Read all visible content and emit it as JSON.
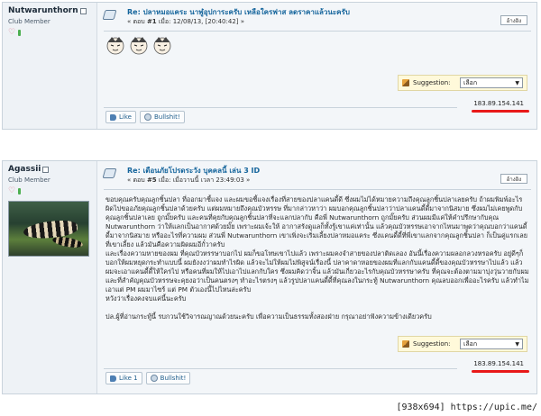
{
  "posts": [
    {
      "username": "Nutwarunthorn",
      "user_title": "Club Member",
      "title": "Re: ปลาหมอแคระ นาฬูอุปการะครับ เหลือใครฟาส ลดราคาแล้วนะครับ",
      "meta_prefix": "« ตอบ ",
      "post_no": "#1",
      "meta_mid": " เมื่อ: ",
      "date": "12/08/13, [20:40:42]",
      "meta_suffix": " »",
      "quote_label": "อ้างอิง",
      "suggestion_label": "Suggestion:",
      "suggestion_value": "เลือก",
      "ip": "183.89.154.141",
      "like_label": "Like",
      "bullshit_label": "Bullshit!"
    },
    {
      "username": "Agassii",
      "user_title": "Club Member",
      "title": "Re: เตือนภัยโปรดระวัง บุคคลนี้ เล่น 3 ID",
      "meta_prefix": "« ตอบ ",
      "post_no": "#5",
      "meta_mid": " เมื่อ: ",
      "date": "เมื่อวานนี้ เวลา 23:49:03",
      "meta_suffix": " »",
      "quote_label": "อ้างอิง",
      "body": "ขอบคุณครับคุณลูกชิ้นปลา ที่ออกมาชี้แจง และผมขอชี้แจงเรื่องที่สายของปลาแคนดี้ดี ซึ่งผมไม่ได้หมายความถึงคุณลูกชิ้นปลาเลยครับ ถ้าผมพิมพ์อะไรผิดไปขออภัยคุณลูกชิ้นปลาด้วยครับ แต่ผมหมายถึงคุณบัวหรรษ ที่มากล่าวหาว่า ผมบอกคุณลูกชิ้นปลาว่าปลาแคนดี้ดี้มาจากนิสมาย ซึ่งผมไม่เคยพูดกับคุณลูกชิ้นปลาเลย ถูกมั๊ยครับ และคนที่คุยกับคุณลูกชิ้นปลาที่จะแลกปลากับ คือพี่ Nutwarunthorn ถูกมั๊ยครับ ส่วนผมมีแค่ให้คำปรึกษากับคุณ Nutwarunthorn ว่าให้แลกเป็นอากาศด้วยมั๊ย เพราะผมเจ้ะให้ อากาสรังดูแลก็ทั้งรู้เขาแค่เท่านั้น แล้วคุณบัวหรรษเอาจากไหนมาพูดว่าคุณบอกว่าแคนดี้ดี้มาจากนิสมาย หรืออะไรที่ความผม ส่วนพี่ Nutwarunthorn เขาเพิ่งจะเริ่มเลี้ยงปลาหมอแคระ ซึ่งแคนดี้ดี้ที่พี่เขาแลกจากคุณลูกชิ้นปลา ก็เป็นคู่แรกเลยที่เขาเลี้ยง แล้วมันคือความผิดผมอีกั๋วาครับ\nและเรื่องความหายของผม ที่คุณบัวหรรษาบอกไป ผมก็ขอโทษเขาไปแล้ว เพราะผมคงจำสายของปลาติดเลอง อันนี้เรื่องความผลอกลวงหรอครับ อยู่ดีๆก็บอกให้ผมหยุดกระทำแบบนี้ ผมยังงงว่าผมทำไรผิด แล้วจะไม่ให้ผมไม่พิสูจน์เรื่องนี้ ปลาคาดาหอยของผมที่แลกกับแคนดี้ดี้ของคุณบัวหรรษาไปแล้ว แล้วผมจะเอาแคนดี้ดี้ให้ใครไป หรือคนที่ผมให้ไปเอาไปแลกกับใคร ซึ่งผมคิดว่าจิ้น แล้วมันเกี่ยวอะไรกับคุณบัวหรรษาครับ ที่คุณจะต้องตามมาบุ่งวุ่นวายกับผม และที่สำคัญคุณบัวหรรษจะคุยงอว่าเป็นคนตรงๆ ทำอะไรตรงๆ แล้วรูปปลาแคนดี้ดี้ที่คุณลงในกระทู้ Nutwarunthorn คุณลบออกเพื่ออะไรครับ แล้วทำไมเอาแต่ PM ผมมาไซร้ แต่ PM ตัวเองนี้ไปไหนล่ะครับ\nหวังว่าเรื่องคงจบแค่นี้นะครับ\n\nปล.ผู้ที่อ่านกระทู้นี้ รบกวนใช้วิจารณญาณด้วยนะครับ เพื่อความเป็นธรรมทั้งสองฝ่าย กรุณาอย่าฟังความข้างเดียวครับ",
      "suggestion_label": "Suggestion:",
      "suggestion_value": "เลือก",
      "ip": "183.89.154.141",
      "like_label": "Like 1",
      "bullshit_label": "Bullshit!"
    }
  ],
  "footer": "[938x694] https://upic.me/",
  "colors": {
    "title": "#15659c",
    "ip_underline": "#e81919",
    "border": "#c9d3dc"
  },
  "icons": [
    "post-icon",
    "online-status-icon",
    "heart-icon",
    "reputation-icon",
    "pencil-icon",
    "thumbs-up-icon",
    "bullshit-icon",
    "emoticon-face-icon"
  ]
}
